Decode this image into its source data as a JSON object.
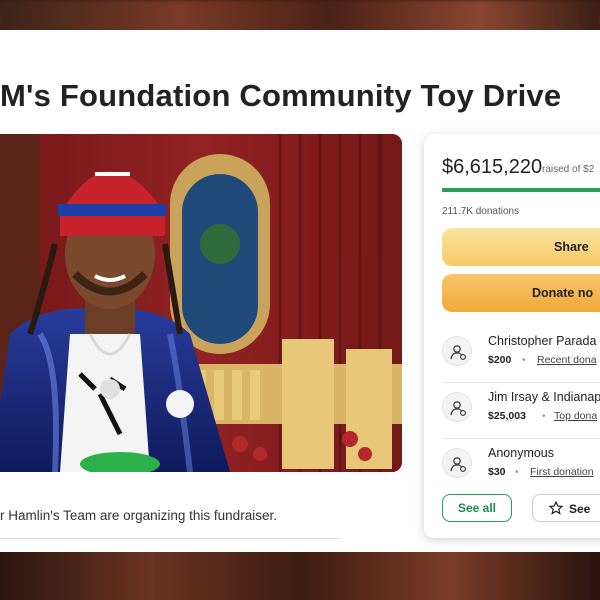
{
  "page": {
    "title": "M's Foundation Community Toy Drive",
    "organizer_text": "r Hamlin's Team are organizing this fundraiser."
  },
  "donation_card": {
    "amount": "$6,615,220",
    "raised_text": "raised of $2",
    "progress": 1.0,
    "donations_count": "211.7K donations",
    "share_label": "Share",
    "donate_label": "Donate no",
    "donors": [
      {
        "name": "Christopher Parada",
        "amount": "$200",
        "tag": "Recent dona"
      },
      {
        "name": "Jim Irsay & Indianap",
        "amount": "$25,003",
        "tag": "Top dona"
      },
      {
        "name": "Anonymous",
        "amount": "$30",
        "tag": "First donation"
      }
    ],
    "see_all_label": "See all",
    "see_label": "See"
  },
  "colors": {
    "accent_green": "#2a9d5c",
    "button_yellow": "#f6c964",
    "button_orange": "#f0a93a"
  }
}
